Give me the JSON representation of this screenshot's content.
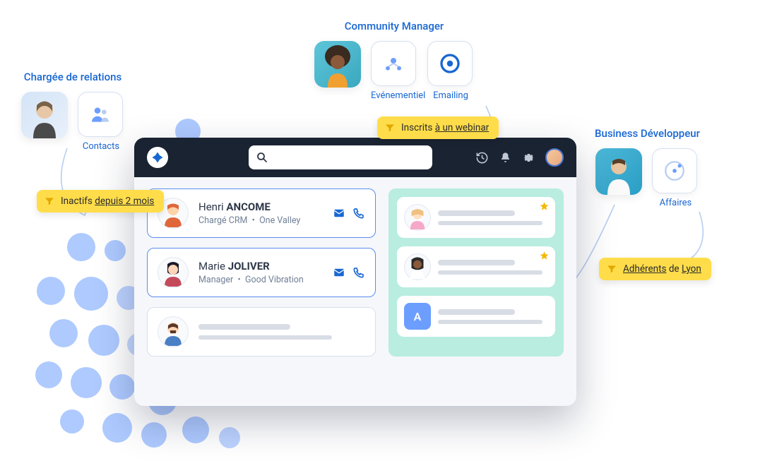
{
  "personas": {
    "relations": {
      "title": "Chargée de relations",
      "tool": "Contacts"
    },
    "community": {
      "title": "Community Manager",
      "tool1": "Evénementiel",
      "tool2": "Emailing"
    },
    "bizdev": {
      "title": "Business Développeur",
      "tool": "Affaires"
    }
  },
  "tags": {
    "inactive": {
      "prefix": "Inactifs ",
      "underlined": "depuis 2 mois"
    },
    "webinar": {
      "prefix": "Inscrits ",
      "underlined": "à un webinar"
    },
    "members": {
      "underlined1": "Adhérents",
      "mid": " de ",
      "underlined2": "Lyon"
    }
  },
  "app": {
    "search_placeholder": "",
    "contacts": [
      {
        "first": "Henri",
        "last": "ANCOME",
        "role": "Chargé CRM",
        "org": "One Valley"
      },
      {
        "first": "Marie",
        "last": "JOLIVER",
        "role": "Manager",
        "org": "Good Vibration"
      }
    ],
    "teal_initial": "A"
  }
}
